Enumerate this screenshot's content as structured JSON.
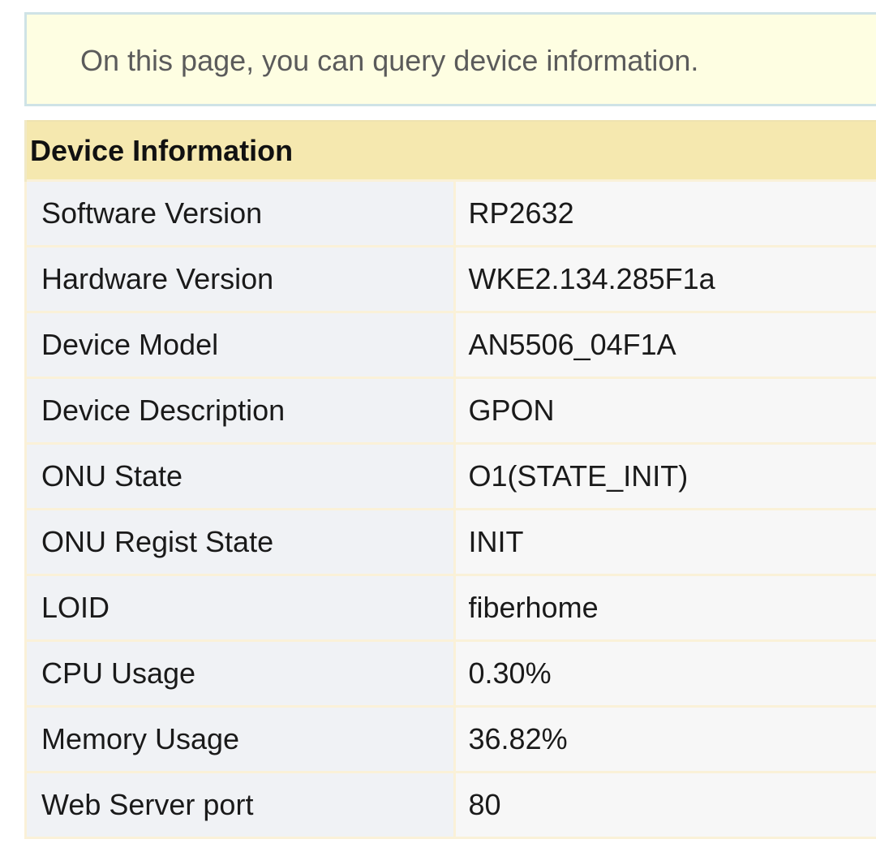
{
  "notice": {
    "text": "On this page, you can query device information."
  },
  "device_info": {
    "title": "Device Information",
    "rows": [
      {
        "label": "Software Version",
        "value": "RP2632"
      },
      {
        "label": "Hardware Version",
        "value": "WKE2.134.285F1a"
      },
      {
        "label": "Device Model",
        "value": "AN5506_04F1A"
      },
      {
        "label": "Device Description",
        "value": "GPON"
      },
      {
        "label": "ONU State",
        "value": "O1(STATE_INIT)"
      },
      {
        "label": "ONU Regist State",
        "value": "INIT"
      },
      {
        "label": "LOID",
        "value": "fiberhome"
      },
      {
        "label": "CPU Usage",
        "value": "0.30%"
      },
      {
        "label": "Memory Usage",
        "value": "36.82%"
      },
      {
        "label": "Web Server port",
        "value": "80"
      }
    ]
  },
  "colors": {
    "notice_background": "#fefee2",
    "notice_border": "#cfe3e6",
    "header_background": "#f5e8af",
    "label_cell_background": "#f0f2f5",
    "value_cell_background": "#f7f7f7",
    "cell_border": "#faf1d8"
  }
}
